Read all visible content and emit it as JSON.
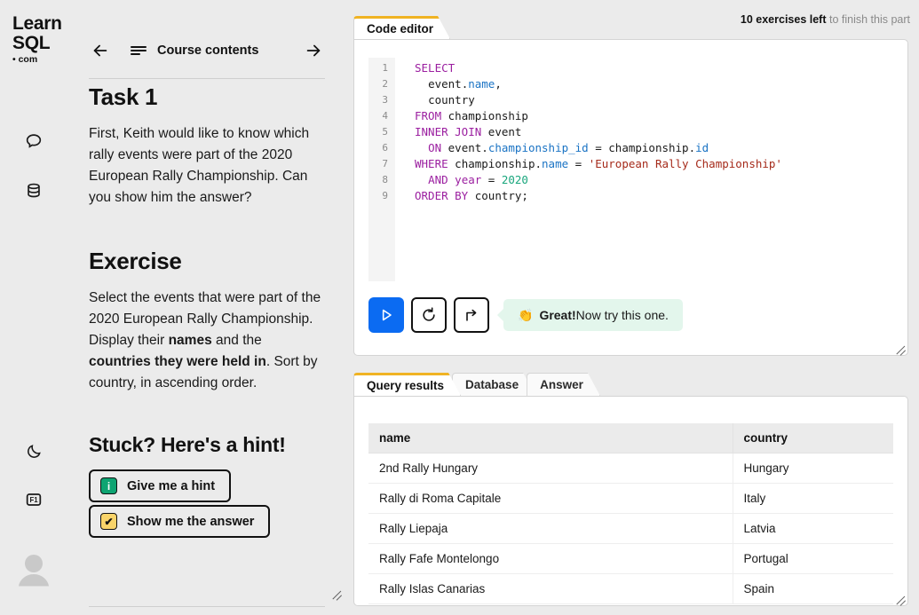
{
  "brand": {
    "line1": "Learn",
    "line2": "SQL",
    "line3": "• com"
  },
  "rail": {
    "icons": [
      {
        "name": "chat-icon"
      },
      {
        "name": "database-icon"
      },
      {
        "name": "moon-icon"
      },
      {
        "name": "f1-key-icon",
        "label": "F1"
      },
      {
        "name": "avatar-icon"
      }
    ]
  },
  "nav": {
    "back_label": "←",
    "menu_label": "menu",
    "title": "Course contents",
    "forward_label": "→"
  },
  "task": {
    "heading": "Task 1",
    "paragraph": "First, Keith would like to know which rally events were part of the 2020 European Rally Championship. Can you show him the answer?"
  },
  "exercise": {
    "heading": "Exercise",
    "text_1": "Select the events that were part of the 2020 European Rally Championship. Display their ",
    "bold_1": "names",
    "text_2": " and the ",
    "bold_2": "countries they were held in",
    "text_3": ". Sort by country, in ascending order."
  },
  "hint": {
    "heading": "Stuck? Here's a hint!",
    "buttons": [
      {
        "label": "Give me a hint",
        "icon": "info-icon",
        "glyph": "i"
      },
      {
        "label": "Show me the answer",
        "icon": "check-icon",
        "glyph": "✔"
      }
    ]
  },
  "status": {
    "bold": "10 exercises left",
    "rest": " to finish this part"
  },
  "editor": {
    "tab_label": "Code editor",
    "line_numbers": [
      "1",
      "2",
      "3",
      "4",
      "5",
      "6",
      "7",
      "8",
      "9"
    ],
    "code_plain": "SELECT\n  event.name,\n  country\nFROM championship\nINNER JOIN event\n  ON event.championship_id = championship.id\nWHERE championship.name = 'European Rally Championship'\n  AND year = 2020\nORDER BY country;",
    "buttons": [
      {
        "name": "run-query-button",
        "icon": "play-icon"
      },
      {
        "name": "reset-button",
        "icon": "undo-icon"
      },
      {
        "name": "next-exercise-button",
        "icon": "arrow-turn-right-icon"
      }
    ],
    "tooltip": {
      "emoji": "👏",
      "bold": "Great!",
      "rest": " Now try this one."
    }
  },
  "results": {
    "tabs": [
      {
        "label": "Query results",
        "active": true
      },
      {
        "label": "Database",
        "active": false
      },
      {
        "label": "Answer",
        "active": false
      }
    ],
    "columns": [
      "name",
      "country"
    ],
    "rows": [
      [
        "2nd Rally Hungary",
        "Hungary"
      ],
      [
        "Rally di Roma Capitale",
        "Italy"
      ],
      [
        "Rally Liepaja",
        "Latvia"
      ],
      [
        "Rally Fafe Montelongo",
        "Portugal"
      ],
      [
        "Rally Islas Canarias",
        "Spain"
      ]
    ]
  },
  "colors": {
    "background": "#ebebeb",
    "accent_tab": "#f0b323",
    "run_button": "#0b6bf2",
    "tooltip_bg": "#e3f6ec",
    "badge_info": "#0ea472",
    "badge_check": "#f9d46a"
  }
}
